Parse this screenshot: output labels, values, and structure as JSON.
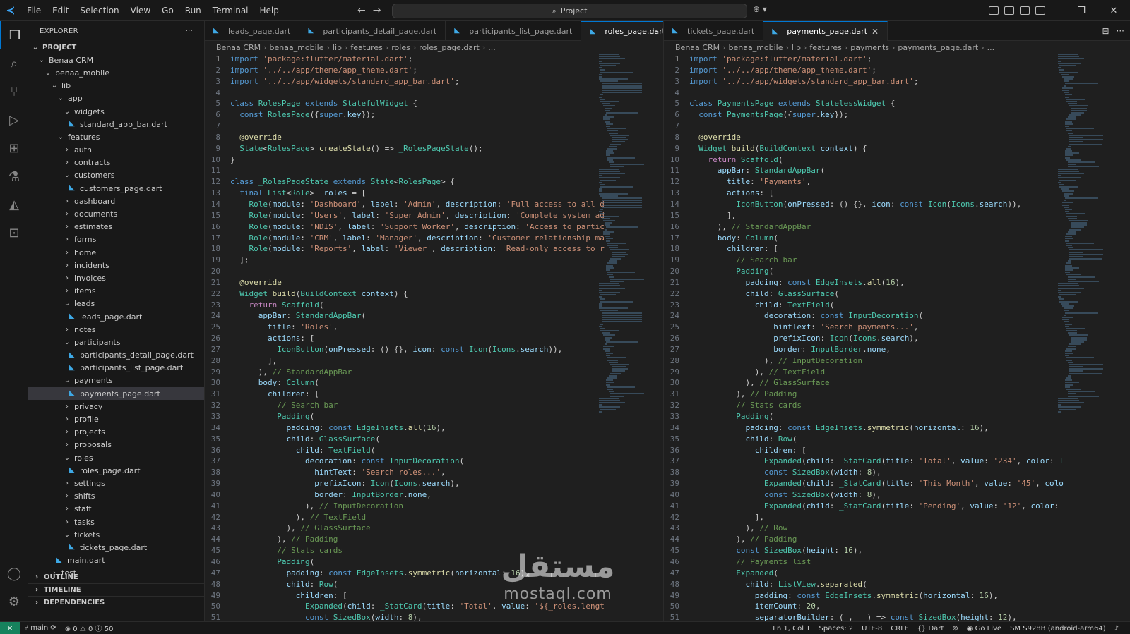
{
  "menu": [
    "File",
    "Edit",
    "Selection",
    "View",
    "Go",
    "Run",
    "Terminal",
    "Help"
  ],
  "command_center": "Project",
  "sidebar": {
    "title": "EXPLORER",
    "tree": [
      {
        "label": "PROJECT",
        "depth": 0,
        "kind": "section",
        "open": true
      },
      {
        "label": "Benaa CRM",
        "depth": 1,
        "kind": "folder",
        "open": true
      },
      {
        "label": "benaa_mobile",
        "depth": 2,
        "kind": "folder",
        "open": true
      },
      {
        "label": "lib",
        "depth": 3,
        "kind": "folder",
        "open": true
      },
      {
        "label": "app",
        "depth": 4,
        "kind": "folder",
        "open": true
      },
      {
        "label": "widgets",
        "depth": 5,
        "kind": "folder",
        "open": true
      },
      {
        "label": "standard_app_bar.dart",
        "depth": 6,
        "kind": "file"
      },
      {
        "label": "features",
        "depth": 4,
        "kind": "folder",
        "open": true
      },
      {
        "label": "auth",
        "depth": 5,
        "kind": "folder",
        "open": false
      },
      {
        "label": "contracts",
        "depth": 5,
        "kind": "folder",
        "open": false
      },
      {
        "label": "customers",
        "depth": 5,
        "kind": "folder",
        "open": true
      },
      {
        "label": "customers_page.dart",
        "depth": 6,
        "kind": "file"
      },
      {
        "label": "dashboard",
        "depth": 5,
        "kind": "folder",
        "open": false
      },
      {
        "label": "documents",
        "depth": 5,
        "kind": "folder",
        "open": false
      },
      {
        "label": "estimates",
        "depth": 5,
        "kind": "folder",
        "open": false
      },
      {
        "label": "forms",
        "depth": 5,
        "kind": "folder",
        "open": false
      },
      {
        "label": "home",
        "depth": 5,
        "kind": "folder",
        "open": false
      },
      {
        "label": "incidents",
        "depth": 5,
        "kind": "folder",
        "open": false
      },
      {
        "label": "invoices",
        "depth": 5,
        "kind": "folder",
        "open": false
      },
      {
        "label": "items",
        "depth": 5,
        "kind": "folder",
        "open": false
      },
      {
        "label": "leads",
        "depth": 5,
        "kind": "folder",
        "open": true
      },
      {
        "label": "leads_page.dart",
        "depth": 6,
        "kind": "file"
      },
      {
        "label": "notes",
        "depth": 5,
        "kind": "folder",
        "open": false
      },
      {
        "label": "participants",
        "depth": 5,
        "kind": "folder",
        "open": true
      },
      {
        "label": "participants_detail_page.dart",
        "depth": 6,
        "kind": "file"
      },
      {
        "label": "participants_list_page.dart",
        "depth": 6,
        "kind": "file"
      },
      {
        "label": "payments",
        "depth": 5,
        "kind": "folder",
        "open": true
      },
      {
        "label": "payments_page.dart",
        "depth": 6,
        "kind": "file",
        "selected": true
      },
      {
        "label": "privacy",
        "depth": 5,
        "kind": "folder",
        "open": false
      },
      {
        "label": "profile",
        "depth": 5,
        "kind": "folder",
        "open": false
      },
      {
        "label": "projects",
        "depth": 5,
        "kind": "folder",
        "open": false
      },
      {
        "label": "proposals",
        "depth": 5,
        "kind": "folder",
        "open": false
      },
      {
        "label": "roles",
        "depth": 5,
        "kind": "folder",
        "open": true
      },
      {
        "label": "roles_page.dart",
        "depth": 6,
        "kind": "file"
      },
      {
        "label": "settings",
        "depth": 5,
        "kind": "folder",
        "open": false
      },
      {
        "label": "shifts",
        "depth": 5,
        "kind": "folder",
        "open": false
      },
      {
        "label": "staff",
        "depth": 5,
        "kind": "folder",
        "open": false
      },
      {
        "label": "tasks",
        "depth": 5,
        "kind": "folder",
        "open": false
      },
      {
        "label": "tickets",
        "depth": 5,
        "kind": "folder",
        "open": true
      },
      {
        "label": "tickets_page.dart",
        "depth": 6,
        "kind": "file"
      },
      {
        "label": "main.dart",
        "depth": 4,
        "kind": "file"
      },
      {
        "label": "test",
        "depth": 3,
        "kind": "folder",
        "open": false
      }
    ],
    "bottom_sections": [
      "OUTLINE",
      "TIMELINE",
      "DEPENDENCIES"
    ]
  },
  "left_editor": {
    "tabs": [
      {
        "label": "leads_page.dart",
        "active": false
      },
      {
        "label": "participants_detail_page.dart",
        "active": false
      },
      {
        "label": "participants_list_page.dart",
        "active": false
      },
      {
        "label": "roles_page.dart",
        "active": true
      }
    ],
    "breadcrumb": [
      "Benaa CRM",
      "benaa_mobile",
      "lib",
      "features",
      "roles",
      "roles_page.dart",
      "..."
    ],
    "lines": [
      "<k>import</k> <s>'package:flutter/material.dart'</s>;",
      "<k>import</k> <s>'../../app/theme/app_theme.dart'</s>;",
      "<k>import</k> <s>'../../app/widgets/standard_app_bar.dart'</s>;",
      "",
      "<k>class</k> <t>RolesPage</t> <k>extends</k> <t>StatefulWidget</t> {",
      "  <k>const</k> <t>RolesPage</t>({<k>super</k>.<p>key</p>});",
      "",
      "  <a>@override</a>",
      "  <t>State</t>&lt;<t>RolesPage</t>&gt; <f>createState</f>() =&gt; <t>_RolesPageState</t>();",
      "}",
      "",
      "<k>class</k> <t>_RolesPageState</t> <k>extends</k> <t>State</t>&lt;<t>RolesPage</t>&gt; {",
      "  <k>final</k> <t>List</t>&lt;<t>Role</t>&gt; <p>_roles</p> = [",
      "    <t>Role</t>(<p>module</p>: <s>'Dashboard'</s>, <p>label</p>: <s>'Admin'</s>, <p>description</p>: <s>'Full access to all d</s>",
      "    <t>Role</t>(<p>module</p>: <s>'Users'</s>, <p>label</p>: <s>'Super Admin'</s>, <p>description</p>: <s>'Complete system ad</s>",
      "    <t>Role</t>(<p>module</p>: <s>'NDIS'</s>, <p>label</p>: <s>'Support Worker'</s>, <p>description</p>: <s>'Access to partic</s>",
      "    <t>Role</t>(<p>module</p>: <s>'CRM'</s>, <p>label</p>: <s>'Manager'</s>, <p>description</p>: <s>'Customer relationship ma</s>",
      "    <t>Role</t>(<p>module</p>: <s>'Reports'</s>, <p>label</p>: <s>'Viewer'</s>, <p>description</p>: <s>'Read-only access to r</s>",
      "  ];",
      "",
      "  <a>@override</a>",
      "  <t>Widget</t> <f>build</f>(<t>BuildContext</t> <p>context</p>) {",
      "    <kw>return</kw> <t>Scaffold</t>(",
      "      <p>appBar</p>: <t>StandardAppBar</t>(",
      "        <p>title</p>: <s>'Roles'</s>,",
      "        <p>actions</p>: [",
      "          <t>IconButton</t>(<p>onPressed</p>: () {}, <p>icon</p>: <k>const</k> <t>Icon</t>(<t>Icons</t>.<p>search</p>)),",
      "        ],",
      "      ), <c>// StandardAppBar</c>",
      "      <p>body</p>: <t>Column</t>(",
      "        <p>children</p>: [",
      "          <c>// Search bar</c>",
      "          <t>Padding</t>(",
      "            <p>padding</p>: <k>const</k> <t>EdgeInsets</t>.<f>all</f>(<n>16</n>),",
      "            <p>child</p>: <t>GlassSurface</t>(",
      "              <p>child</p>: <t>TextField</t>(",
      "                <p>decoration</p>: <k>const</k> <t>InputDecoration</t>(",
      "                  <p>hintText</p>: <s>'Search roles...'</s>,",
      "                  <p>prefixIcon</p>: <t>Icon</t>(<t>Icons</t>.<p>search</p>),",
      "                  <p>border</p>: <t>InputBorder</t>.<p>none</p>,",
      "                ), <c>// InputDecoration</c>",
      "              ), <c>// TextField</c>",
      "            ), <c>// GlassSurface</c>",
      "          ), <c>// Padding</c>",
      "          <c>// Stats cards</c>",
      "          <t>Padding</t>(",
      "            <p>padding</p>: <k>const</k> <t>EdgeInsets</t>.<f>symmetric</f>(<p>horizontal</p>: <n>16</n>),",
      "            <p>child</p>: <t>Row</t>(",
      "              <p>children</p>: [",
      "                <t>Expanded</t>(<p>child</p>: <t>_StatCard</t>(<p>title</p>: <s>'Total'</s>, <p>value</p>: <s>'${_roles.lengt</s>",
      "                <k>const</k> <t>SizedBox</t>(<p>width</p>: <n>8</n>),"
    ]
  },
  "right_editor": {
    "tabs": [
      {
        "label": "tickets_page.dart",
        "active": false
      },
      {
        "label": "payments_page.dart",
        "active": true
      }
    ],
    "breadcrumb": [
      "Benaa CRM",
      "benaa_mobile",
      "lib",
      "features",
      "payments",
      "payments_page.dart",
      "..."
    ],
    "lines": [
      "<k>import</k> <s>'package:flutter/material.dart'</s>;",
      "<k>import</k> <s>'../../app/theme/app_theme.dart'</s>;",
      "<k>import</k> <s>'../../app/widgets/standard_app_bar.dart'</s>;",
      "",
      "<k>class</k> <t>PaymentsPage</t> <k>extends</k> <t>StatelessWidget</t> {",
      "  <k>const</k> <t>PaymentsPage</t>({<k>super</k>.<p>key</p>});",
      "",
      "  <a>@override</a>",
      "  <t>Widget</t> <f>build</f>(<t>BuildContext</t> <p>context</p>) {",
      "    <kw>return</kw> <t>Scaffold</t>(",
      "      <p>appBar</p>: <t>StandardAppBar</t>(",
      "        <p>title</p>: <s>'Payments'</s>,",
      "        <p>actions</p>: [",
      "          <t>IconButton</t>(<p>onPressed</p>: () {}, <p>icon</p>: <k>const</k> <t>Icon</t>(<t>Icons</t>.<p>search</p>)),",
      "        ],",
      "      ), <c>// StandardAppBar</c>",
      "      <p>body</p>: <t>Column</t>(",
      "        <p>children</p>: [",
      "          <c>// Search bar</c>",
      "          <t>Padding</t>(",
      "            <p>padding</p>: <k>const</k> <t>EdgeInsets</t>.<f>all</f>(<n>16</n>),",
      "            <p>child</p>: <t>GlassSurface</t>(",
      "              <p>child</p>: <t>TextField</t>(",
      "                <p>decoration</p>: <k>const</k> <t>InputDecoration</t>(",
      "                  <p>hintText</p>: <s>'Search payments...'</s>,",
      "                  <p>prefixIcon</p>: <t>Icon</t>(<t>Icons</t>.<p>search</p>),",
      "                  <p>border</p>: <t>InputBorder</t>.<p>none</p>,",
      "                ), <c>// InputDecoration</c>",
      "              ), <c>// TextField</c>",
      "            ), <c>// GlassSurface</c>",
      "          ), <c>// Padding</c>",
      "          <c>// Stats cards</c>",
      "          <t>Padding</t>(",
      "            <p>padding</p>: <k>const</k> <t>EdgeInsets</t>.<f>symmetric</f>(<p>horizontal</p>: <n>16</n>),",
      "            <p>child</p>: <t>Row</t>(",
      "              <p>children</p>: [",
      "                <t>Expanded</t>(<p>child</p>: <t>_StatCard</t>(<p>title</p>: <s>'Total'</s>, <p>value</p>: <s>'234'</s>, <p>color</p>: <t>I</t>",
      "                <k>const</k> <t>SizedBox</t>(<p>width</p>: <n>8</n>),",
      "                <t>Expanded</t>(<p>child</p>: <t>_StatCard</t>(<p>title</p>: <s>'This Month'</s>, <p>value</p>: <s>'45'</s>, <p>colo</p>",
      "                <k>const</k> <t>SizedBox</t>(<p>width</p>: <n>8</n>),",
      "                <t>Expanded</t>(<p>child</p>: <t>_StatCard</t>(<p>title</p>: <s>'Pending'</s>, <p>value</p>: <s>'12'</s>, <p>color</p>:",
      "              ],",
      "            ), <c>// Row</c>",
      "          ), <c>// Padding</c>",
      "          <k>const</k> <t>SizedBox</t>(<p>height</p>: <n>16</n>),",
      "          <c>// Payments list</c>",
      "          <t>Expanded</t>(",
      "            <p>child</p>: <t>ListView</t>.<f>separated</f>(",
      "              <p>padding</p>: <k>const</k> <t>EdgeInsets</t>.<f>symmetric</f>(<p>horizontal</p>: <n>16</n>),",
      "              <p>itemCount</p>: <n>20</n>,",
      "              <p>separatorBuilder</p>: (_, __) =&gt; <k>const</k> <t>SizedBox</t>(<p>height</p>: <n>12</n>),"
    ]
  },
  "statusbar": {
    "branch": "main",
    "problems": "⊗ 0 ⚠ 0 ⓘ 50",
    "position": "Ln 1, Col 1",
    "spaces": "Spaces: 2",
    "encoding": "UTF-8",
    "eol": "CRLF",
    "language": "{} Dart",
    "golive": "Go Live",
    "device": "SM S928B (android-arm64)"
  },
  "watermark": {
    "arabic": "مستقل",
    "latin": "mostaql.com"
  }
}
